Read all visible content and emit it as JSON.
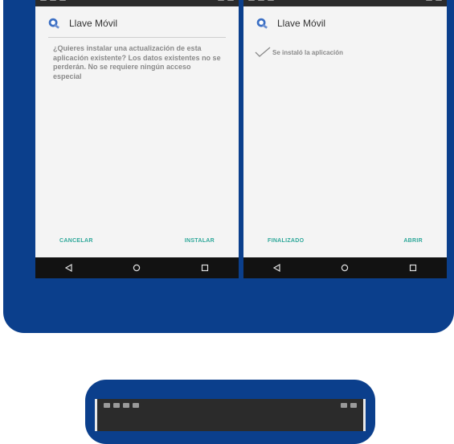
{
  "left_phone": {
    "app_title": "Llave Móvil",
    "message": "¿Quieres instalar una actualización de esta aplicación existente? Los datos existentes no se perderán.  No se requiere ningún acceso especial",
    "buttons": {
      "cancel": "CANCELAR",
      "install": "INSTALAR"
    }
  },
  "right_phone": {
    "app_title": "Llave Móvil",
    "status_message": "Se instaló la aplicación",
    "buttons": {
      "done": "FINALIZADO",
      "open": "ABRIR"
    }
  },
  "colors": {
    "panel": "#0b3f8c",
    "action_text": "#2fa89a",
    "status_bar": "#2b2b2b",
    "nav_bar": "#121212"
  },
  "icons": [
    "app-icon",
    "check-icon",
    "back-icon",
    "home-icon",
    "recents-icon"
  ]
}
